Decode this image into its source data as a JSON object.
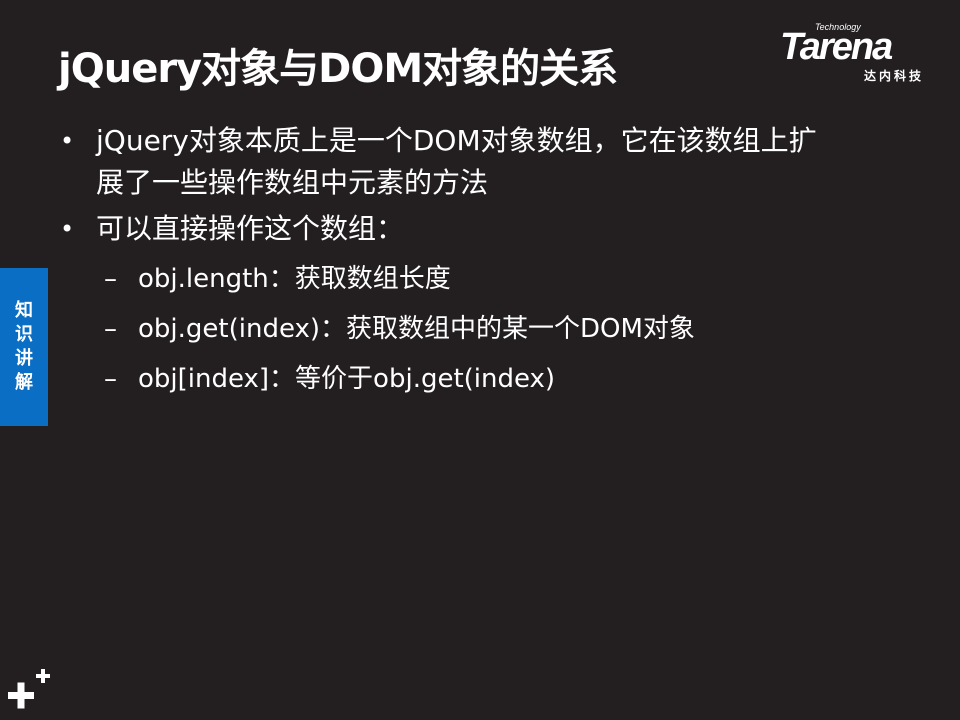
{
  "slide": {
    "title": "jQuery对象与DOM对象的关系",
    "logo": {
      "technology": "Technology",
      "brand": "Tarena",
      "subtitle": "达内科技"
    },
    "side_tab": [
      "知",
      "识",
      "讲",
      "解"
    ],
    "bullets": [
      {
        "text_line1": "jQuery对象本质上是一个DOM对象数组，它在该数组上扩",
        "text_line2": "展了一些操作数组中元素的方法"
      },
      {
        "text_line1": "可以直接操作这个数组：",
        "subitems": [
          "obj.length：获取数组长度",
          "obj.get(index)：获取数组中的某一个DOM对象",
          "obj[index]：等价于obj.get(index)"
        ]
      }
    ],
    "bullet_glyph": "•",
    "dash_glyph": "–"
  },
  "colors": {
    "background": "#231f20",
    "text": "#ffffff",
    "side_tab": "#0a6ec4"
  }
}
